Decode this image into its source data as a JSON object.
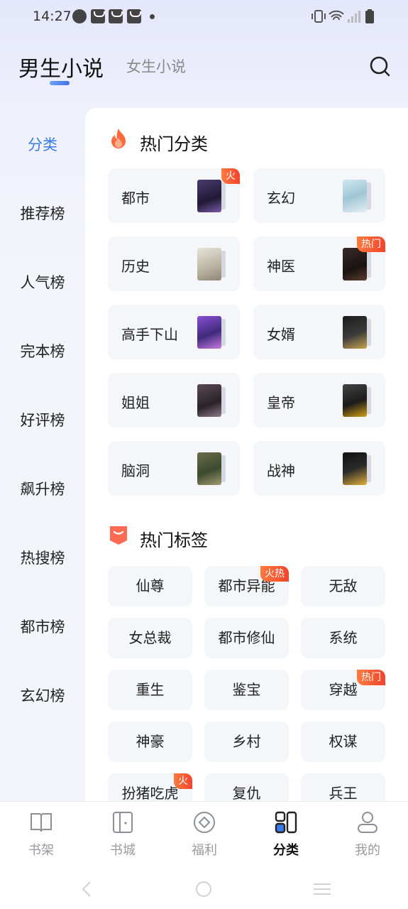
{
  "status_bar": {
    "time": "14:27"
  },
  "header": {
    "tab_male": "男生小说",
    "tab_female": "女生小说"
  },
  "sidebar": {
    "items": [
      {
        "label": "分类",
        "active": true
      },
      {
        "label": "推荐榜"
      },
      {
        "label": "人气榜"
      },
      {
        "label": "完本榜"
      },
      {
        "label": "好评榜"
      },
      {
        "label": "飙升榜"
      },
      {
        "label": "热搜榜"
      },
      {
        "label": "都市榜"
      },
      {
        "label": "玄幻榜"
      }
    ]
  },
  "hot_categories": {
    "title": "热门分类",
    "items": [
      {
        "label": "都市",
        "badge": "火"
      },
      {
        "label": "玄幻",
        "badge": ""
      },
      {
        "label": "历史",
        "badge": ""
      },
      {
        "label": "神医",
        "badge": "热门"
      },
      {
        "label": "高手下山",
        "badge": ""
      },
      {
        "label": "女婿",
        "badge": ""
      },
      {
        "label": "姐姐",
        "badge": ""
      },
      {
        "label": "皇帝",
        "badge": ""
      },
      {
        "label": "脑洞",
        "badge": ""
      },
      {
        "label": "战神",
        "badge": ""
      }
    ]
  },
  "hot_tags": {
    "title": "热门标签",
    "items": [
      {
        "label": "仙尊",
        "badge": ""
      },
      {
        "label": "都市异能",
        "badge": "火热"
      },
      {
        "label": "无敌",
        "badge": ""
      },
      {
        "label": "女总裁",
        "badge": ""
      },
      {
        "label": "都市修仙",
        "badge": ""
      },
      {
        "label": "系统",
        "badge": ""
      },
      {
        "label": "重生",
        "badge": ""
      },
      {
        "label": "鉴宝",
        "badge": ""
      },
      {
        "label": "穿越",
        "badge": "热门"
      },
      {
        "label": "神豪",
        "badge": ""
      },
      {
        "label": "乡村",
        "badge": ""
      },
      {
        "label": "权谋",
        "badge": ""
      },
      {
        "label": "扮猪吃虎",
        "badge": "火"
      },
      {
        "label": "复仇",
        "badge": ""
      },
      {
        "label": "兵王",
        "badge": ""
      }
    ]
  },
  "bottom_nav": {
    "items": [
      {
        "label": "书架",
        "icon": "book-icon"
      },
      {
        "label": "书城",
        "icon": "store-icon"
      },
      {
        "label": "福利",
        "icon": "gift-icon"
      },
      {
        "label": "分类",
        "icon": "category-icon",
        "active": true
      },
      {
        "label": "我的",
        "icon": "profile-icon"
      }
    ]
  },
  "colors": {
    "accent": "#3b7be8",
    "badge": "#f2442d"
  }
}
